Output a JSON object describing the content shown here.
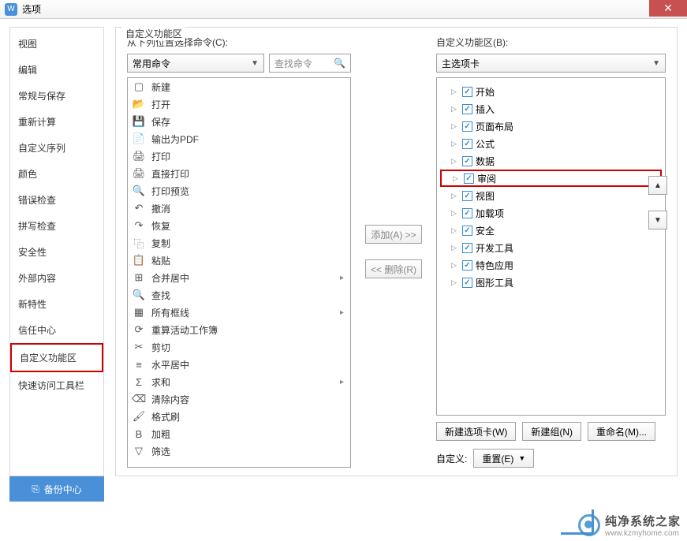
{
  "window": {
    "title": "选项"
  },
  "sidebar": {
    "items": [
      "视图",
      "编辑",
      "常规与保存",
      "重新计算",
      "自定义序列",
      "颜色",
      "错误检查",
      "拼写检查",
      "安全性",
      "外部内容",
      "新特性",
      "信任中心",
      "自定义功能区",
      "快速访问工具栏"
    ],
    "selected_index": 12
  },
  "content": {
    "title": "自定义功能区",
    "left": {
      "label": "从下列位置选择命令(C):",
      "dropdown": "常用命令",
      "search_placeholder": "查找命令",
      "commands": [
        {
          "icon": "new-icon",
          "glyph": "▢",
          "label": "新建"
        },
        {
          "icon": "open-icon",
          "glyph": "📂",
          "label": "打开"
        },
        {
          "icon": "save-icon",
          "glyph": "💾",
          "label": "保存"
        },
        {
          "icon": "pdf-icon",
          "glyph": "📄",
          "label": "输出为PDF"
        },
        {
          "icon": "print-icon",
          "glyph": "🖨",
          "label": "打印"
        },
        {
          "icon": "direct-print-icon",
          "glyph": "🖨",
          "label": "直接打印"
        },
        {
          "icon": "print-preview-icon",
          "glyph": "🔍",
          "label": "打印预览"
        },
        {
          "icon": "undo-icon",
          "glyph": "↶",
          "label": "撤消"
        },
        {
          "icon": "redo-icon",
          "glyph": "↷",
          "label": "恢复"
        },
        {
          "icon": "copy-icon",
          "glyph": "⿻",
          "label": "复制"
        },
        {
          "icon": "paste-icon",
          "glyph": "📋",
          "label": "粘贴"
        },
        {
          "icon": "merge-center-icon",
          "glyph": "⊞",
          "label": "合并居中",
          "sub": "▸"
        },
        {
          "icon": "find-icon",
          "glyph": "🔍",
          "label": "查找"
        },
        {
          "icon": "borders-icon",
          "glyph": "▦",
          "label": "所有框线",
          "sub": "▸"
        },
        {
          "icon": "recalc-icon",
          "glyph": "⟳",
          "label": "重算活动工作簿"
        },
        {
          "icon": "cut-icon",
          "glyph": "✂",
          "label": "剪切"
        },
        {
          "icon": "hcenter-icon",
          "glyph": "≡",
          "label": "水平居中"
        },
        {
          "icon": "sum-icon",
          "glyph": "Σ",
          "label": "求和",
          "sub": "▸"
        },
        {
          "icon": "clear-icon",
          "glyph": "⌫",
          "label": "清除内容"
        },
        {
          "icon": "format-painter-icon",
          "glyph": "🖌",
          "label": "格式刷"
        },
        {
          "icon": "bold-icon",
          "glyph": "B",
          "label": "加粗"
        },
        {
          "icon": "filter-icon",
          "glyph": "▽",
          "label": "筛选"
        }
      ]
    },
    "mid": {
      "add": "添加(A) >>",
      "remove": "<< 删除(R)"
    },
    "right": {
      "label": "自定义功能区(B):",
      "dropdown": "主选项卡",
      "tabs": [
        {
          "label": "开始",
          "hl": false
        },
        {
          "label": "插入",
          "hl": false
        },
        {
          "label": "页面布局",
          "hl": false
        },
        {
          "label": "公式",
          "hl": false
        },
        {
          "label": "数据",
          "hl": false
        },
        {
          "label": "审阅",
          "hl": true
        },
        {
          "label": "视图",
          "hl": false
        },
        {
          "label": "加载项",
          "hl": false
        },
        {
          "label": "安全",
          "hl": false
        },
        {
          "label": "开发工具",
          "hl": false
        },
        {
          "label": "特色应用",
          "hl": false
        },
        {
          "label": "图形工具",
          "hl": false
        }
      ],
      "buttons": {
        "new_tab": "新建选项卡(W)",
        "new_group": "新建组(N)",
        "rename": "重命名(M)..."
      },
      "custom_label": "自定义:",
      "reset": "重置(E)"
    }
  },
  "backup": "备份中心",
  "watermark": {
    "line1": "纯净系统之家",
    "line2": "www.kzmyhome.com"
  }
}
